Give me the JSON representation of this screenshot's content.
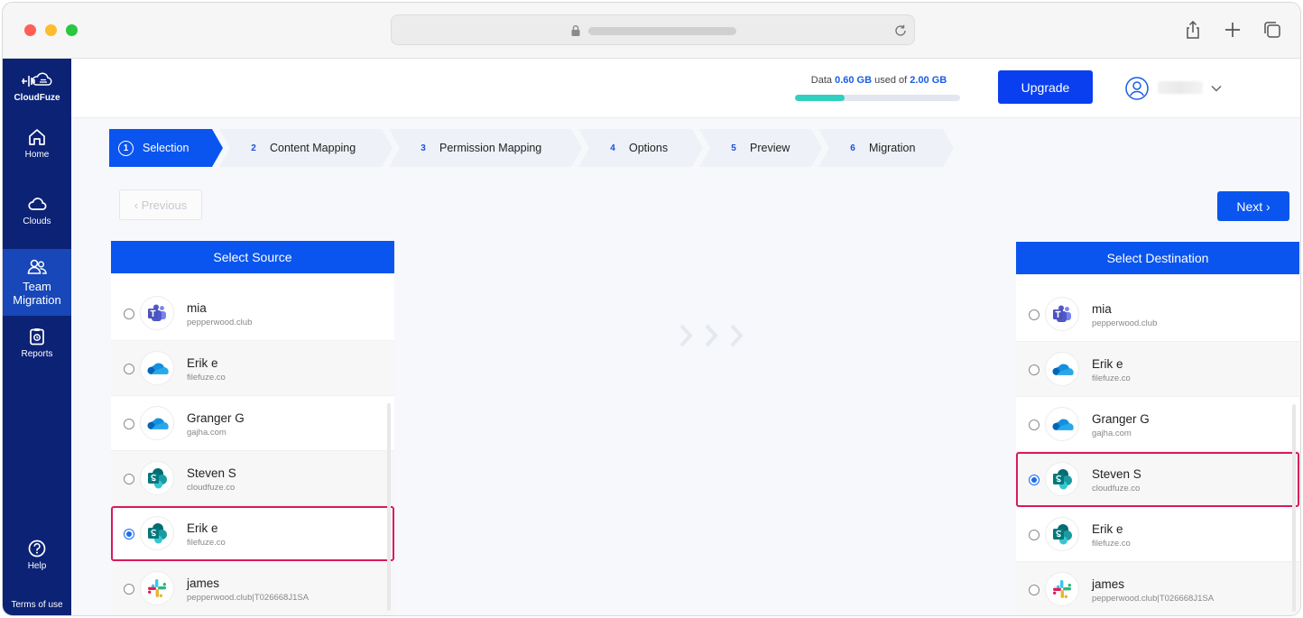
{
  "sidebar": {
    "logo_text": "CloudFuze",
    "items": [
      {
        "label": "Home",
        "icon": "home-icon"
      },
      {
        "label": "Clouds",
        "icon": "cloud-icon"
      },
      {
        "label": "Team Migration",
        "icon": "team-icon",
        "active": true
      },
      {
        "label": "Reports",
        "icon": "reports-icon"
      },
      {
        "label": "Help",
        "icon": "help-icon"
      }
    ],
    "terms": "Terms of use"
  },
  "header": {
    "storage_prefix": "Data",
    "storage_used": "0.60 GB",
    "storage_mid": "used of",
    "storage_total": "2.00 GB",
    "storage_fraction": 0.3,
    "upgrade_label": "Upgrade"
  },
  "steps": [
    {
      "num": "1",
      "label": "Selection",
      "active": true
    },
    {
      "num": "2",
      "label": "Content Mapping"
    },
    {
      "num": "3",
      "label": "Permission Mapping"
    },
    {
      "num": "4",
      "label": "Options"
    },
    {
      "num": "5",
      "label": "Preview"
    },
    {
      "num": "6",
      "label": "Migration"
    }
  ],
  "buttons": {
    "previous": "‹ Previous",
    "next": "Next ›"
  },
  "source": {
    "title": "Select Source",
    "rows": [
      {
        "name": "mia",
        "domain": "pepperwood.club",
        "icon": "teams-icon"
      },
      {
        "name": "Erik e",
        "domain": "filefuze.co",
        "icon": "onedrive-icon"
      },
      {
        "name": "Granger G",
        "domain": "gajha.com",
        "icon": "onedrive-icon"
      },
      {
        "name": "Steven S",
        "domain": "cloudfuze.co",
        "icon": "sharepoint-icon"
      },
      {
        "name": "Erik e",
        "domain": "filefuze.co",
        "icon": "sharepoint-icon",
        "selected": true
      },
      {
        "name": "james",
        "domain": "pepperwood.club|T026668J1SA",
        "icon": "slack-icon"
      }
    ]
  },
  "destination": {
    "title": "Select Destination",
    "rows": [
      {
        "name": "mia",
        "domain": "pepperwood.club",
        "icon": "teams-icon"
      },
      {
        "name": "Erik e",
        "domain": "filefuze.co",
        "icon": "onedrive-icon"
      },
      {
        "name": "Granger G",
        "domain": "gajha.com",
        "icon": "onedrive-icon"
      },
      {
        "name": "Steven S",
        "domain": "cloudfuze.co",
        "icon": "sharepoint-icon",
        "selected": true
      },
      {
        "name": "Erik e",
        "domain": "filefuze.co",
        "icon": "sharepoint-icon"
      },
      {
        "name": "james",
        "domain": "pepperwood.club|T026668J1SA",
        "icon": "slack-icon"
      }
    ]
  },
  "colors": {
    "sidebar": "#0b2275",
    "accent": "#0a55ef",
    "highlight": "#d81b5a"
  }
}
